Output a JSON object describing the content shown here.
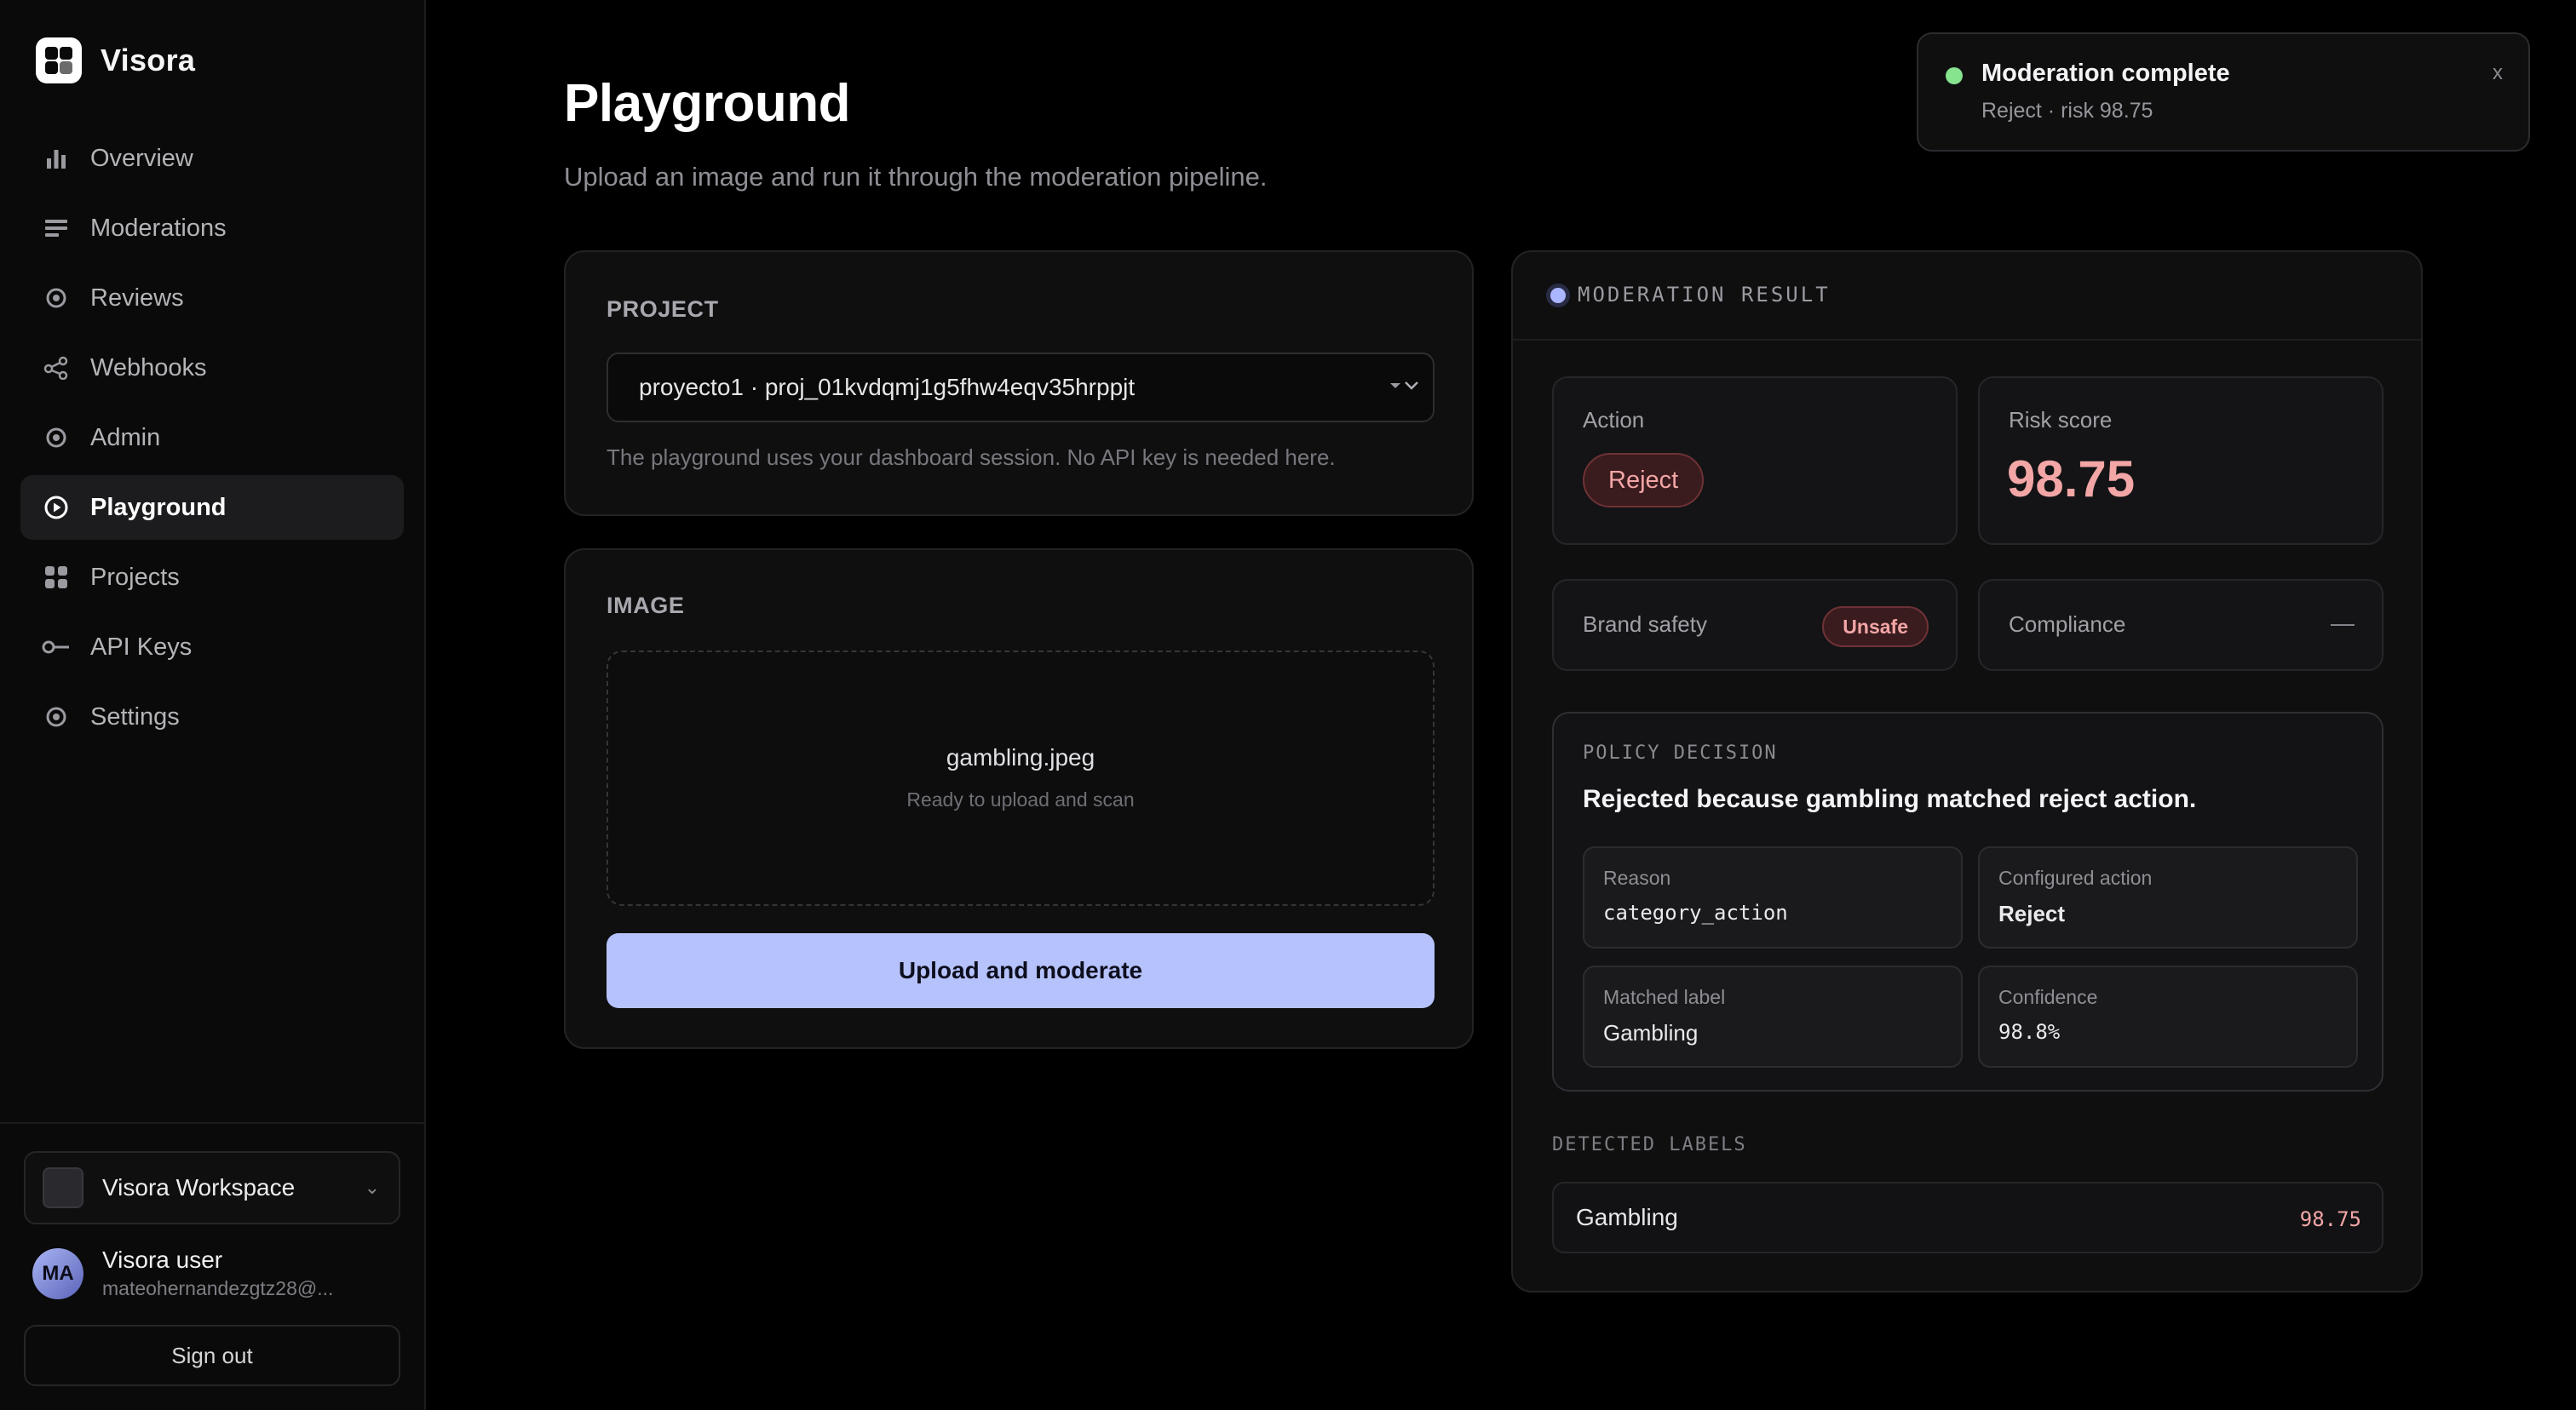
{
  "app": {
    "name": "Visora"
  },
  "sidebar": {
    "items": [
      {
        "label": "Overview",
        "icon": "bar-chart-icon",
        "active": false
      },
      {
        "label": "Moderations",
        "icon": "list-icon",
        "active": false
      },
      {
        "label": "Reviews",
        "icon": "target-icon",
        "active": false
      },
      {
        "label": "Webhooks",
        "icon": "share-nodes-icon",
        "active": false
      },
      {
        "label": "Admin",
        "icon": "target-icon",
        "active": false
      },
      {
        "label": "Playground",
        "icon": "play-circle-icon",
        "active": true
      },
      {
        "label": "Projects",
        "icon": "grid-icon",
        "active": false
      },
      {
        "label": "API Keys",
        "icon": "key-icon",
        "active": false
      },
      {
        "label": "Settings",
        "icon": "target-icon",
        "active": false
      }
    ],
    "workspace": {
      "name": "Visora Workspace",
      "chevron": "⌄"
    },
    "user": {
      "initials": "MA",
      "name": "Visora user",
      "email": "mateohernandezgtz28@..."
    },
    "sign_out": "Sign out"
  },
  "main": {
    "title": "Playground",
    "subtitle": "Upload an image and run it through the moderation pipeline.",
    "project": {
      "label": "PROJECT",
      "selected": "proyecto1 · proj_01kvdqmj1g5fhw4eqv35hrppjt",
      "hint": "The playground uses your dashboard session. No API key is needed here."
    },
    "image": {
      "label": "IMAGE",
      "file_name": "gambling.jpeg",
      "file_status": "Ready to upload and scan",
      "upload_button": "Upload and moderate"
    }
  },
  "result": {
    "title": "MODERATION RESULT",
    "action_label": "Action",
    "action_value": "Reject",
    "risk_label": "Risk score",
    "risk_value": "98.75",
    "brand_safety_label": "Brand safety",
    "brand_safety_value": "Unsafe",
    "compliance_label": "Compliance",
    "compliance_value": "—",
    "policy": {
      "label": "POLICY DECISION",
      "text": "Rejected because gambling matched reject action.",
      "reason_label": "Reason",
      "reason_value": "category_action",
      "configured_label": "Configured action",
      "configured_value": "Reject",
      "matched_label": "Matched label",
      "matched_value": "Gambling",
      "confidence_label": "Confidence",
      "confidence_value": "98.8%"
    },
    "detected_labels_title": "DETECTED LABELS",
    "detected_labels": [
      {
        "name": "Gambling",
        "score": "98.75"
      }
    ]
  },
  "toast": {
    "title": "Moderation complete",
    "message": "Reject · risk 98.75",
    "close": "x"
  },
  "colors": {
    "accent": "#b6c2fb",
    "danger_text": "#f3a6a6",
    "success_dot": "#86e38e"
  }
}
